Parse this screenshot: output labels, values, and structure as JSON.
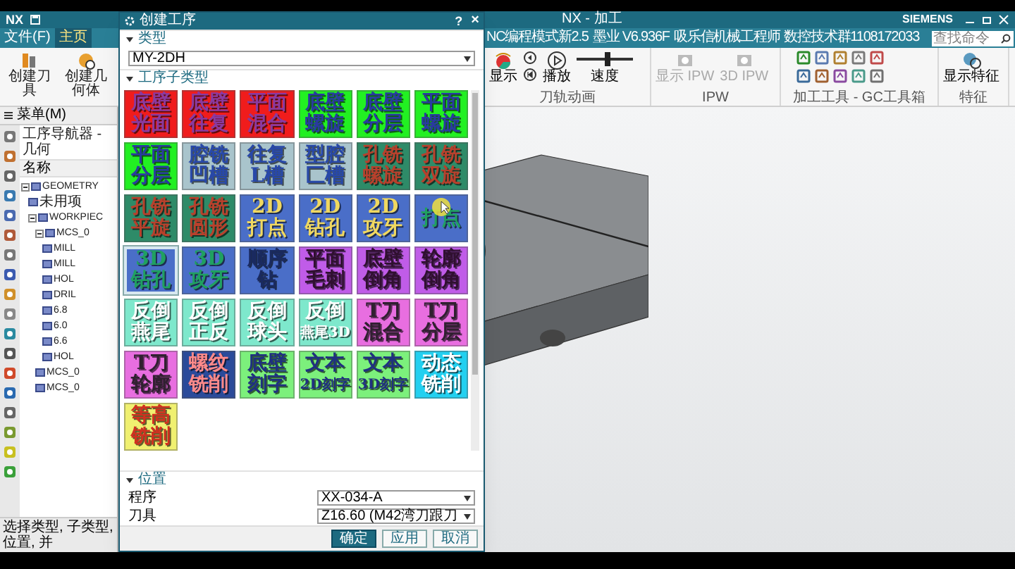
{
  "app": {
    "logo": "NX",
    "title": "NX - 加工",
    "brand": "SIEMENS"
  },
  "menu_tabs": [
    {
      "label": "文件(F)",
      "selected": false
    },
    {
      "label": "主页",
      "selected": true
    }
  ],
  "ribbon_tabs": [
    {
      "label": "NC编程模式新2.5"
    },
    {
      "label": "墨业 V6.936F"
    },
    {
      "label": "吸乐信机械工程师"
    },
    {
      "label": "数控技术群1108172033"
    }
  ],
  "search": {
    "placeholder": "查找命令"
  },
  "ribbon_left": [
    {
      "label": "创建刀具"
    },
    {
      "label": "创建几何体"
    }
  ],
  "animation_group": {
    "label": "刀轨动画",
    "display": "显示",
    "play": "播放",
    "speed": {
      "label": "速度",
      "level": 0.55
    }
  },
  "ipw_group": {
    "label": "IPW",
    "buttons": [
      {
        "label": "显示 IPW",
        "disabled": true
      },
      {
        "label": "3D IPW",
        "disabled": true
      }
    ]
  },
  "tools_group": {
    "label": "加工工具 - GC工具箱"
  },
  "feature_group": {
    "label": "特征",
    "button": "显示特征"
  },
  "navigator": {
    "menu": "菜单(M)",
    "title": "工序导航器 - 几何",
    "column": "名称",
    "tree": [
      {
        "label": "GEOMETRY",
        "expanded": true,
        "children": [
          {
            "label": "未用项"
          },
          {
            "label": "WORKPIEC",
            "expanded": true,
            "children": [
              {
                "label": "MCS_0",
                "expanded": true,
                "children": [
                  {
                    "label": "MILL"
                  },
                  {
                    "label": "MILL"
                  },
                  {
                    "label": "HOL"
                  },
                  {
                    "label": "DRIL"
                  },
                  {
                    "label": "6.8"
                  },
                  {
                    "label": "6.0"
                  },
                  {
                    "label": "6.6"
                  },
                  {
                    "label": "HOL"
                  }
                ]
              },
              {
                "label": "MCS_0"
              },
              {
                "label": "MCS_0"
              }
            ]
          }
        ]
      }
    ]
  },
  "status_bar": "选择类型, 子类型, 位置, 并",
  "dialog": {
    "title": "创建工序",
    "help": "?",
    "close": "×",
    "type_section": {
      "label": "类型",
      "expanded": true,
      "value": "MY-2DH"
    },
    "subtype_section": {
      "label": "工序子类型",
      "expanded": true,
      "tiles": [
        {
          "lines": [
            "底壁",
            "光面"
          ],
          "color": "#f01c1c",
          "kind": "floor",
          "selected": false
        },
        {
          "lines": [
            "底壁",
            "往复"
          ],
          "color": "#f01c1c",
          "kind": "floor",
          "selected": false
        },
        {
          "lines": [
            "平面",
            "混合"
          ],
          "color": "#f01c1c",
          "kind": "floor",
          "selected": false
        },
        {
          "lines": [
            "底壁",
            "螺旋"
          ],
          "color": "#22f022",
          "kind": "spiral",
          "selected": false
        },
        {
          "lines": [
            "底壁",
            "分层"
          ],
          "color": "#22f022",
          "kind": "spiral",
          "selected": false
        },
        {
          "lines": [
            "平面",
            "螺旋"
          ],
          "color": "#22f022",
          "kind": "spiral",
          "selected": false
        },
        {
          "lines": [
            "平面",
            "分层"
          ],
          "color": "#22f022",
          "kind": "spiral",
          "selected": false
        },
        {
          "lines": [
            "腔铣",
            "凹槽"
          ],
          "color": "#a9c4cc",
          "kind": "pocket",
          "selected": false
        },
        {
          "lines": [
            "往复",
            "L槽"
          ],
          "color": "#a9c4cc",
          "kind": "pocket",
          "selected": false
        },
        {
          "lines": [
            "型腔",
            "匚槽"
          ],
          "color": "#a9c4cc",
          "kind": "pocket",
          "selected": false
        },
        {
          "lines": [
            "孔铣",
            "螺旋"
          ],
          "color": "#2e8b68",
          "kind": "hole",
          "selected": false
        },
        {
          "lines": [
            "孔铣",
            "双旋"
          ],
          "color": "#2e8b68",
          "kind": "hole",
          "selected": false
        },
        {
          "lines": [
            "孔铣",
            "平旋"
          ],
          "color": "#2e8b68",
          "kind": "hole",
          "selected": false
        },
        {
          "lines": [
            "孔铣",
            "圆形"
          ],
          "color": "#2e8b68",
          "kind": "hole",
          "selected": false
        },
        {
          "lines": [
            "2D",
            "打点"
          ],
          "color": "#4a6ec8",
          "kind": "drill2d",
          "selected": false
        },
        {
          "lines": [
            "2D",
            "钻孔"
          ],
          "color": "#4a6ec8",
          "kind": "drill2d",
          "selected": false
        },
        {
          "lines": [
            "2D",
            "攻牙"
          ],
          "color": "#4a6ec8",
          "kind": "drill2d",
          "selected": false
        },
        {
          "lines": [
            "打点"
          ],
          "color": "#4a6ec8",
          "kind": "drill3d",
          "selected": false
        },
        {
          "lines": [
            "3D",
            "钻孔"
          ],
          "color": "#4a6ec8",
          "kind": "drill3d",
          "selected": true
        },
        {
          "lines": [
            "3D",
            "攻牙"
          ],
          "color": "#4a6ec8",
          "kind": "drill3d",
          "selected": false
        },
        {
          "lines": [
            "顺序",
            "钻"
          ],
          "color": "#4a6ec8",
          "kind": "sequence",
          "selected": false
        },
        {
          "lines": [
            "平面",
            "毛刺"
          ],
          "color": "#c05ce8",
          "kind": "chamfer",
          "selected": false
        },
        {
          "lines": [
            "底壁",
            "倒角"
          ],
          "color": "#c05ce8",
          "kind": "chamfer",
          "selected": false
        },
        {
          "lines": [
            "轮廓",
            "倒角"
          ],
          "color": "#c05ce8",
          "kind": "chamfer",
          "selected": false
        },
        {
          "lines": [
            "反倒",
            "燕尾"
          ],
          "color": "#7ee8cc",
          "kind": "reverse",
          "selected": false
        },
        {
          "lines": [
            "反倒",
            "正反"
          ],
          "color": "#7ee8cc",
          "kind": "reverse",
          "selected": false
        },
        {
          "lines": [
            "反倒",
            "球头"
          ],
          "color": "#7ee8cc",
          "kind": "reverse",
          "selected": false
        },
        {
          "lines": [
            "反倒",
            "燕尾3D"
          ],
          "color": "#7ee8cc",
          "kind": "reverse",
          "selected": false
        },
        {
          "lines": [
            "T刀",
            "混合"
          ],
          "color": "#e86ee0",
          "kind": "tcutter",
          "selected": false
        },
        {
          "lines": [
            "T刀",
            "分层"
          ],
          "color": "#e86ee0",
          "kind": "tcutter",
          "selected": false
        },
        {
          "lines": [
            "T刀",
            "轮廓"
          ],
          "color": "#e86ee0",
          "kind": "tcutter",
          "selected": false
        },
        {
          "lines": [
            "螺纹",
            "铣削"
          ],
          "color": "#2a4a9a",
          "kind": "thread",
          "selected": false
        },
        {
          "lines": [
            "底壁",
            "刻字"
          ],
          "color": "#7cf07c",
          "kind": "engrave",
          "selected": false
        },
        {
          "lines": [
            "文本",
            "2D刻字"
          ],
          "color": "#7cf07c",
          "kind": "engrave",
          "selected": false
        },
        {
          "lines": [
            "文本",
            "3D刻字"
          ],
          "color": "#7cf07c",
          "kind": "engrave",
          "selected": false
        },
        {
          "lines": [
            "动态",
            "铣削"
          ],
          "color": "#22d0f0",
          "kind": "dynamic",
          "selected": false
        },
        {
          "lines": [
            "等高",
            "铣削"
          ],
          "color": "#f0f070",
          "kind": "zlevel",
          "selected": false
        }
      ]
    },
    "location_section": {
      "label": "位置",
      "expanded": true,
      "fields": [
        {
          "label": "程序",
          "value": "XX-034-A"
        },
        {
          "label": "刀具",
          "value": "Z16.60 (M42湾刀跟刀"
        }
      ]
    },
    "buttons": [
      {
        "label": "确定",
        "kind": "primary"
      },
      {
        "label": "应用",
        "kind": "normal"
      },
      {
        "label": "取消",
        "kind": "normal"
      }
    ]
  }
}
